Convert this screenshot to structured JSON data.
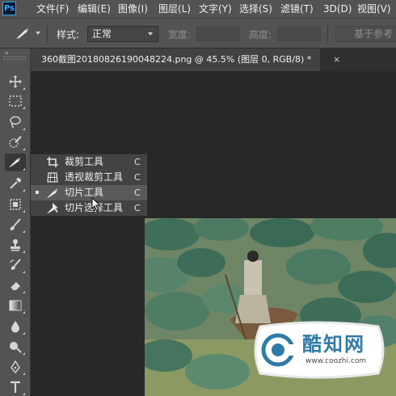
{
  "app": {
    "logo": "Ps"
  },
  "menu": [
    {
      "label": "文件(F)"
    },
    {
      "label": "编辑(E)"
    },
    {
      "label": "图像(I)"
    },
    {
      "label": "图层(L)"
    },
    {
      "label": "文字(Y)"
    },
    {
      "label": "选择(S)"
    },
    {
      "label": "滤镜(T)"
    },
    {
      "label": "3D(D)"
    },
    {
      "label": "视图(V)"
    }
  ],
  "options": {
    "style_label": "样式:",
    "style_value": "正常",
    "width_label": "宽度:",
    "height_label": "高度:",
    "guides_button": "基于参考"
  },
  "document": {
    "tab_title": "360截图20180826190048224.png @ 45.5% (图层 0, RGB/8) *",
    "close_glyph": "×"
  },
  "toolbar": {
    "collapse_glyph": "»"
  },
  "flyout": {
    "items": [
      {
        "label": "裁剪工具",
        "shortcut": "C",
        "icon": "crop-icon",
        "selected": false,
        "highlighted": false
      },
      {
        "label": "透视裁剪工具",
        "shortcut": "C",
        "icon": "perspective-crop-icon",
        "selected": false,
        "highlighted": false
      },
      {
        "label": "切片工具",
        "shortcut": "C",
        "icon": "slice-icon",
        "selected": true,
        "highlighted": true
      },
      {
        "label": "切片选择工具",
        "shortcut": "C",
        "icon": "slice-select-icon",
        "selected": false,
        "highlighted": false
      }
    ]
  },
  "watermark": {
    "name": "酷知网",
    "url": "www.coozhi.com"
  },
  "colors": {
    "app_bg": "#282828",
    "panel": "#535353",
    "accent": "#31a8ff",
    "watermark_blue": "#2e7ba8"
  }
}
